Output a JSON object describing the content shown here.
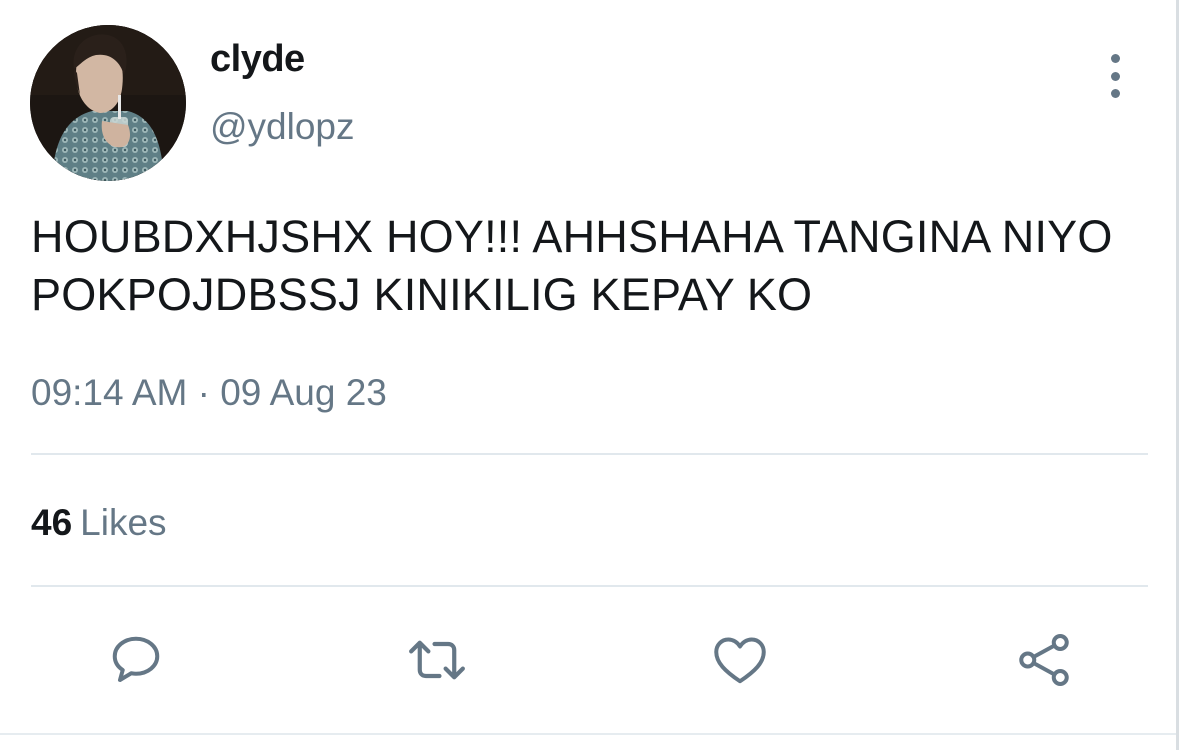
{
  "tweet": {
    "author": {
      "display_name": "clyde",
      "handle": "@ydlopz"
    },
    "text": "HOUBDXHJSHX HOY!!! AHHSHAHA TANGINA NIYO POKPOJDBSSJ KINIKILIG KEPAY KO",
    "timestamp": "09:14 AM · 09 Aug 23",
    "likes": {
      "count": "46",
      "label": "Likes"
    }
  },
  "icons": {
    "more": "more-vertical-icon",
    "reply": "reply-icon",
    "retweet": "retweet-icon",
    "like": "heart-icon",
    "share": "share-icon"
  },
  "colors": {
    "text": "#14171a",
    "secondary": "#657786",
    "divider": "#e1e8ed"
  }
}
